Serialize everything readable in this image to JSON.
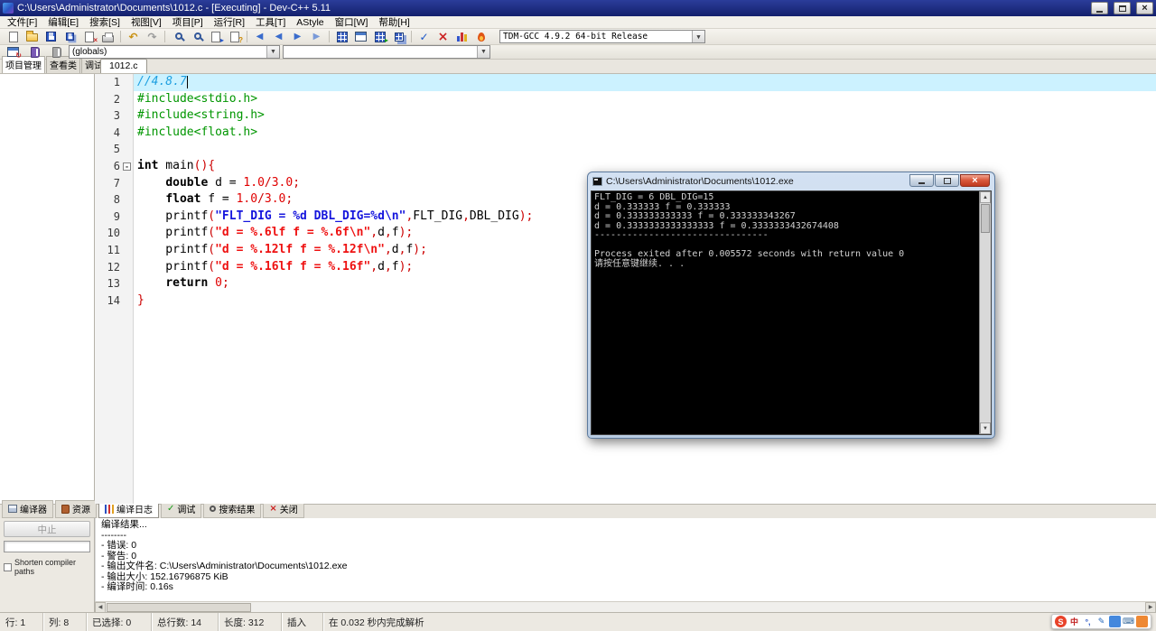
{
  "window": {
    "title": "C:\\Users\\Administrator\\Documents\\1012.c - [Executing] - Dev-C++ 5.11"
  },
  "menu": {
    "items": [
      "文件[F]",
      "编辑[E]",
      "搜索[S]",
      "视图[V]",
      "项目[P]",
      "运行[R]",
      "工具[T]",
      "AStyle",
      "窗口[W]",
      "帮助[H]"
    ]
  },
  "toolbar": {
    "compiler_profile": "TDM-GCC 4.9.2 64-bit Release"
  },
  "toolbar2": {
    "globals": "(globals)",
    "members": ""
  },
  "left_panel": {
    "tabs": [
      {
        "label": "项目管理",
        "active": true
      },
      {
        "label": "查看类",
        "active": false
      },
      {
        "label": "调试",
        "active": false
      }
    ]
  },
  "editor": {
    "tab": "1012.c",
    "lines": [
      {
        "n": 1,
        "hl": true,
        "caret": true,
        "tokens": [
          {
            "c": "com",
            "t": "//4.8.7"
          }
        ]
      },
      {
        "n": 2,
        "tokens": [
          {
            "c": "inc",
            "t": "#include<stdio.h>"
          }
        ]
      },
      {
        "n": 3,
        "tokens": [
          {
            "c": "inc",
            "t": "#include<string.h>"
          }
        ]
      },
      {
        "n": 4,
        "tokens": [
          {
            "c": "inc",
            "t": "#include<float.h>"
          }
        ]
      },
      {
        "n": 5,
        "tokens": []
      },
      {
        "n": 6,
        "fold": true,
        "tokens": [
          {
            "c": "kw",
            "t": "int"
          },
          {
            "c": "pl",
            "t": " main"
          },
          {
            "c": "sym",
            "t": "(){"
          }
        ]
      },
      {
        "n": 7,
        "tokens": [
          {
            "c": "pl",
            "t": "    "
          },
          {
            "c": "kw",
            "t": "double"
          },
          {
            "c": "pl",
            "t": " d = "
          },
          {
            "c": "num",
            "t": "1.0"
          },
          {
            "c": "sym",
            "t": "/"
          },
          {
            "c": "num",
            "t": "3.0"
          },
          {
            "c": "sym",
            "t": ";"
          }
        ]
      },
      {
        "n": 8,
        "tokens": [
          {
            "c": "pl",
            "t": "    "
          },
          {
            "c": "kw",
            "t": "float"
          },
          {
            "c": "pl",
            "t": " f = "
          },
          {
            "c": "num",
            "t": "1.0"
          },
          {
            "c": "sym",
            "t": "/"
          },
          {
            "c": "num",
            "t": "3.0"
          },
          {
            "c": "sym",
            "t": ";"
          }
        ]
      },
      {
        "n": 9,
        "tokens": [
          {
            "c": "pl",
            "t": "    printf"
          },
          {
            "c": "sym",
            "t": "("
          },
          {
            "c": "str2",
            "t": "\"FLT_DIG = %d DBL_DIG=%d\\n\""
          },
          {
            "c": "sym",
            "t": ","
          },
          {
            "c": "pl",
            "t": "FLT_DIG"
          },
          {
            "c": "sym",
            "t": ","
          },
          {
            "c": "pl",
            "t": "DBL_DIG"
          },
          {
            "c": "sym",
            "t": ");"
          }
        ]
      },
      {
        "n": 10,
        "tokens": [
          {
            "c": "pl",
            "t": "    printf"
          },
          {
            "c": "sym",
            "t": "("
          },
          {
            "c": "str",
            "t": "\"d = %.6lf f = %.6f\\n\""
          },
          {
            "c": "sym",
            "t": ","
          },
          {
            "c": "pl",
            "t": "d"
          },
          {
            "c": "sym",
            "t": ","
          },
          {
            "c": "pl",
            "t": "f"
          },
          {
            "c": "sym",
            "t": ");"
          }
        ]
      },
      {
        "n": 11,
        "tokens": [
          {
            "c": "pl",
            "t": "    printf"
          },
          {
            "c": "sym",
            "t": "("
          },
          {
            "c": "str",
            "t": "\"d = %.12lf f = %.12f\\n\""
          },
          {
            "c": "sym",
            "t": ","
          },
          {
            "c": "pl",
            "t": "d"
          },
          {
            "c": "sym",
            "t": ","
          },
          {
            "c": "pl",
            "t": "f"
          },
          {
            "c": "sym",
            "t": ");"
          }
        ]
      },
      {
        "n": 12,
        "tokens": [
          {
            "c": "pl",
            "t": "    printf"
          },
          {
            "c": "sym",
            "t": "("
          },
          {
            "c": "str",
            "t": "\"d = %.16lf f = %.16f\""
          },
          {
            "c": "sym",
            "t": ","
          },
          {
            "c": "pl",
            "t": "d"
          },
          {
            "c": "sym",
            "t": ","
          },
          {
            "c": "pl",
            "t": "f"
          },
          {
            "c": "sym",
            "t": ");"
          }
        ]
      },
      {
        "n": 13,
        "tokens": [
          {
            "c": "pl",
            "t": "    "
          },
          {
            "c": "kw",
            "t": "return"
          },
          {
            "c": "pl",
            "t": " "
          },
          {
            "c": "num",
            "t": "0"
          },
          {
            "c": "sym",
            "t": ";"
          }
        ]
      },
      {
        "n": 14,
        "tokens": [
          {
            "c": "sym",
            "t": "}"
          }
        ]
      }
    ]
  },
  "console": {
    "title": "C:\\Users\\Administrator\\Documents\\1012.exe",
    "lines": [
      "FLT_DIG = 6 DBL_DIG=15",
      "d = 0.333333 f = 0.333333",
      "d = 0.333333333333 f = 0.333333343267",
      "d = 0.3333333333333333 f = 0.3333333432674408",
      "--------------------------------",
      "",
      "Process exited after 0.005572 seconds with return value 0",
      "请按任意键继续. . ."
    ]
  },
  "bottom": {
    "tabs": [
      {
        "label": "编译器",
        "icon": "compiler",
        "active": false
      },
      {
        "label": "资源",
        "icon": "resource",
        "active": false
      },
      {
        "label": "编译日志",
        "icon": "log",
        "active": true
      },
      {
        "label": "调试",
        "icon": "debug",
        "active": false
      },
      {
        "label": "搜索结果",
        "icon": "search",
        "active": false
      },
      {
        "label": "关闭",
        "icon": "close",
        "active": false
      }
    ],
    "abort_label": "中止",
    "shorten_label": "Shorten compiler paths",
    "log": [
      "编译结果...",
      "--------",
      "- 错误: 0",
      "- 警告: 0",
      "- 输出文件名: C:\\Users\\Administrator\\Documents\\1012.exe",
      "- 输出大小: 152.16796875 KiB",
      "- 编译时间: 0.16s"
    ]
  },
  "status": {
    "segments": [
      {
        "text": "行: 1",
        "w": 48
      },
      {
        "text": "列: 8",
        "w": 48
      },
      {
        "text": "已选择: 0",
        "w": 72
      },
      {
        "text": "总行数: 14",
        "w": 74
      },
      {
        "text": "长度: 312",
        "w": 70
      },
      {
        "text": "插入",
        "w": 46
      },
      {
        "text": "在 0.032 秒内完成解析",
        "w": 0
      }
    ]
  },
  "ime": {
    "items": [
      {
        "name": "sogou-logo-icon",
        "glyph": "S",
        "bg": "#e8432b",
        "fg": "#ffffff",
        "round": true
      },
      {
        "name": "ime-mode-icon",
        "glyph": "中",
        "bg": "#ffffff",
        "fg": "#c22222"
      },
      {
        "name": "ime-punct-icon",
        "glyph": "°,",
        "bg": "#ffffff",
        "fg": "#2b57c4"
      },
      {
        "name": "ime-pencil-icon",
        "glyph": "✎",
        "bg": "#ffffff",
        "fg": "#2266bb"
      },
      {
        "name": "ime-mic-icon",
        "glyph": "",
        "bg": "#4488dd",
        "fg": "#ffffff"
      },
      {
        "name": "ime-keyboard-icon",
        "glyph": "⌨",
        "bg": "#ffffff",
        "fg": "#336699"
      },
      {
        "name": "ime-toolbox-icon",
        "glyph": "",
        "bg": "#ee8833",
        "fg": "#ffffff"
      }
    ]
  },
  "colors": {
    "title_bar_blue": "#13206c",
    "line_highlight": "#ccf2ff",
    "string_red": "#ee1111",
    "string_blue": "#1515dd",
    "include_green": "#009600",
    "comment_cyan": "#1e9fe0",
    "console_bg": "#000000",
    "console_text": "#d2d2d2"
  }
}
